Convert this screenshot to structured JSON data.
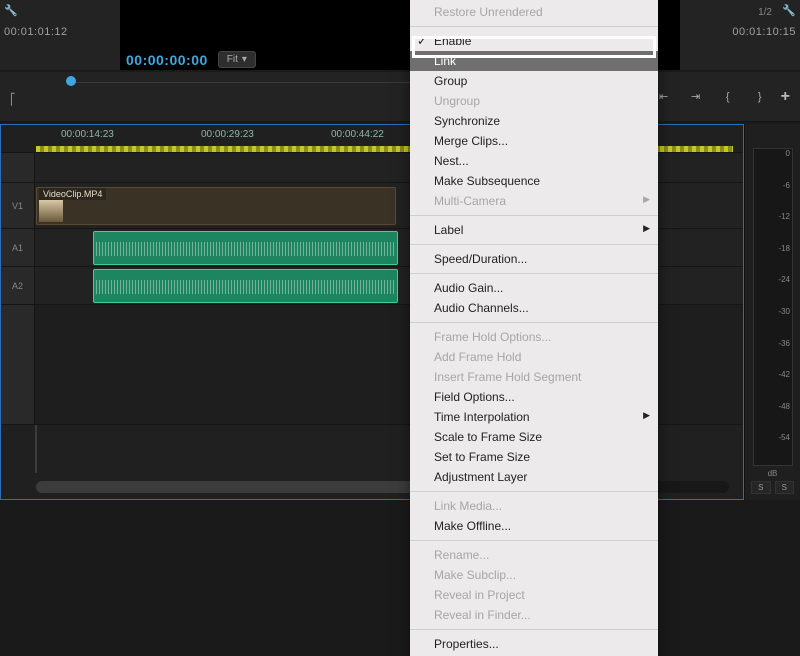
{
  "monitor": {
    "src_tc": "00:01:01:12",
    "prog_tc": "00:00:00:00",
    "out_tc": "00:01:10:15",
    "fit_label": "Fit",
    "fraction": "1/2"
  },
  "ruler": {
    "t1": "00:00:14:23",
    "t2": "00:00:29:23",
    "t3": "00:00:44:22"
  },
  "clip": {
    "name": "VideoClip.MP4"
  },
  "meter": {
    "ticks": [
      "0",
      "-6",
      "-12",
      "-18",
      "-24",
      "-30",
      "-36",
      "-42",
      "-48",
      "-54"
    ],
    "unit": "dB",
    "s1": "S",
    "s2": "S"
  },
  "track": {
    "v1": "V1",
    "a1": "A1",
    "a2": "A2"
  },
  "ctx": {
    "restore": "Restore Unrendered",
    "enable": "Enable",
    "link": "Link",
    "group": "Group",
    "ungroup": "Ungroup",
    "sync": "Synchronize",
    "merge": "Merge Clips...",
    "nest": "Nest...",
    "makesub": "Make Subsequence",
    "multicam": "Multi-Camera",
    "label": "Label",
    "speed": "Speed/Duration...",
    "gain": "Audio Gain...",
    "chan": "Audio Channels...",
    "fho": "Frame Hold Options...",
    "afh": "Add Frame Hold",
    "ifhs": "Insert Frame Hold Segment",
    "fopt": "Field Options...",
    "tinterp": "Time Interpolation",
    "scale": "Scale to Frame Size",
    "setfs": "Set to Frame Size",
    "adj": "Adjustment Layer",
    "linkm": "Link Media...",
    "offline": "Make Offline...",
    "rename": "Rename...",
    "subclip": "Make Subclip...",
    "reveal": "Reveal in Project",
    "revealf": "Reveal in Finder...",
    "props": "Properties..."
  }
}
